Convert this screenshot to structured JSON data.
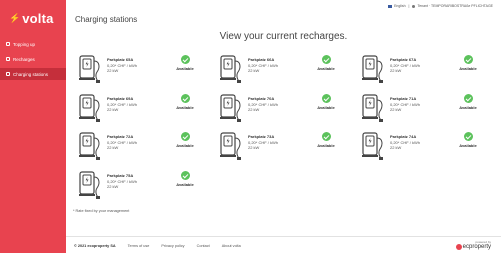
{
  "sidebar": {
    "logo_mark": "⚡",
    "logo_text": "volta",
    "items": [
      {
        "label": "Topping up"
      },
      {
        "label": "Recharges"
      },
      {
        "label": "Charging stations"
      }
    ]
  },
  "header": {
    "title": "Charging stations",
    "language": "English",
    "tenant": "Tenant · TEMPORARIBOSTRAße PFLICHTAGE"
  },
  "main": {
    "heading": "View your current recharges.",
    "stations": [
      {
        "name": "Parkplatz 65A",
        "price": "0,20* CHF / kWh",
        "power": "22 kW",
        "status": "Available"
      },
      {
        "name": "Parkplatz 66A",
        "price": "0,20* CHF / kWh",
        "power": "22 kW",
        "status": "Available"
      },
      {
        "name": "Parkplatz 67A",
        "price": "0,20* CHF / kWh",
        "power": "22 kW",
        "status": "Available"
      },
      {
        "name": "Parkplatz 69A",
        "price": "0,20* CHF / kWh",
        "power": "22 kW",
        "status": "Available"
      },
      {
        "name": "Parkplatz 70A",
        "price": "0,20* CHF / kWh",
        "power": "22 kW",
        "status": "Available"
      },
      {
        "name": "Parkplatz 71A",
        "price": "0,20* CHF / kWh",
        "power": "22 kW",
        "status": "Available"
      },
      {
        "name": "Parkplatz 72A",
        "price": "0,20* CHF / kWh",
        "power": "22 kW",
        "status": "Available"
      },
      {
        "name": "Parkplatz 73A",
        "price": "0,20* CHF / kWh",
        "power": "22 kW",
        "status": "Available"
      },
      {
        "name": "Parkplatz 74A",
        "price": "0,20* CHF / kWh",
        "power": "22 kW",
        "status": "Available"
      },
      {
        "name": "Parkplatz 75A",
        "price": "0,20* CHF / kWh",
        "power": "22 kW",
        "status": "Available"
      }
    ],
    "note": "* Rate fixed by your management"
  },
  "footer": {
    "copyright": "© 2021 ecoproperty SA",
    "links": [
      "Terms of use",
      "Privacy policy",
      "Contact",
      "About volta"
    ],
    "brand_small": "powered by",
    "brand_name": "ecproperty"
  },
  "colors": {
    "sidebar": "#e8434f",
    "active": "#c52f3b",
    "status": "#5cc25c"
  }
}
